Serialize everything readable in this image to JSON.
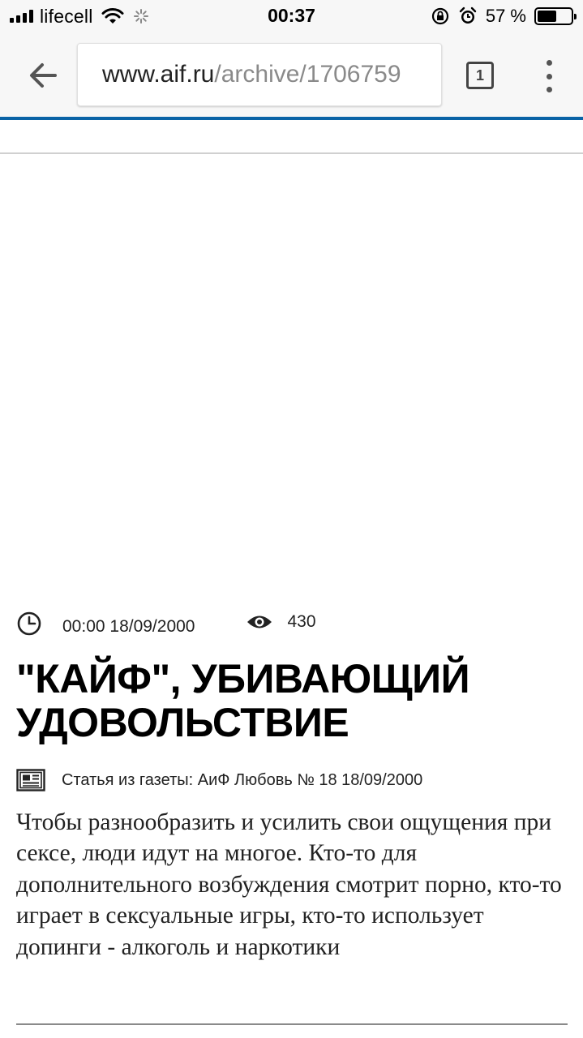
{
  "status_bar": {
    "carrier": "lifecell",
    "time": "00:37",
    "battery_percent": "57 %",
    "battery_level": 0.57,
    "icons": [
      "signal-icon",
      "wifi-icon",
      "loading-spinner-icon",
      "rotation-lock-icon",
      "alarm-icon",
      "battery-icon"
    ]
  },
  "browser": {
    "url_host": "www.aif.ru",
    "url_path": "/archive/1706759",
    "tab_count": "1",
    "icons": [
      "back-arrow-icon",
      "tabs-icon",
      "more-menu-icon"
    ]
  },
  "article": {
    "time_date": "00:00 18/09/2000",
    "views": "430",
    "title": "\"КАЙФ\", УБИВАЮЩИЙ УДОВОЛЬСТВИЕ",
    "source": "Статья из газеты: АиФ Любовь № 18 18/09/2000",
    "lead": "Чтобы разнообразить и усилить свои ощущения при сексе, люди идут на многое. Кто-то для дополнительного возбуждения смотрит порно, кто-то играет в сексуальные игры, кто-то использует допинги - алкоголь и наркотики",
    "icons": [
      "clock-icon",
      "eye-icon",
      "newspaper-icon"
    ]
  },
  "colors": {
    "accent": "#0a63a6",
    "url_path": "#8a8a8a",
    "chrome_bg": "#f7f7f7"
  }
}
